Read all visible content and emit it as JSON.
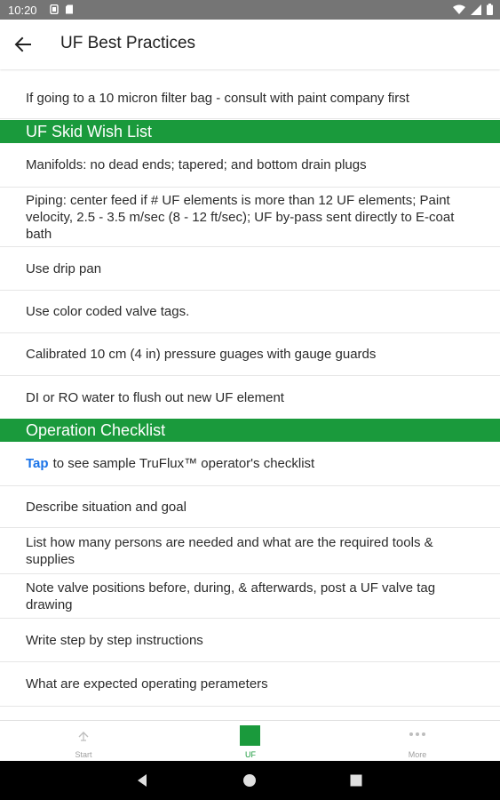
{
  "status_bar": {
    "time": "10:20"
  },
  "header": {
    "title": "UF Best Practices"
  },
  "top_item": "If going to a 10 micron filter bag - consult with paint company first",
  "sections": [
    {
      "title": "UF Skid Wish List",
      "items": [
        "Manifolds: no dead ends; tapered; and bottom drain plugs",
        "Piping: center feed if # UF elements is more than 12 UF elements; Paint velocity, 2.5 - 3.5 m/sec (8 - 12 ft/sec); UF by-pass sent directly to E-coat bath",
        "Use drip pan",
        "Use color coded valve tags.",
        "Calibrated 10 cm (4 in) pressure guages with gauge guards",
        "DI or RO water to flush out new UF element"
      ]
    },
    {
      "title": "Operation Checklist",
      "tap_item": {
        "tap": "Tap",
        "text": "to see sample TruFlux™ operator's checklist"
      },
      "items": [
        "Describe situation and goal",
        "List how many persons are needed and what are the required tools & supplies",
        "Note valve positions before, during, & afterwards, post a UF valve tag drawing",
        "Write step by step instructions",
        "What are expected operating perameters"
      ]
    }
  ],
  "bottom_nav": [
    {
      "label": "Start",
      "icon": "start-icon"
    },
    {
      "label": "UF",
      "icon": "uf-square-icon",
      "active": true
    },
    {
      "label": "More",
      "icon": "more-dots-icon"
    }
  ],
  "colors": {
    "accent": "#1a9a3c",
    "link": "#1a73e8",
    "status_bar": "#757575"
  }
}
